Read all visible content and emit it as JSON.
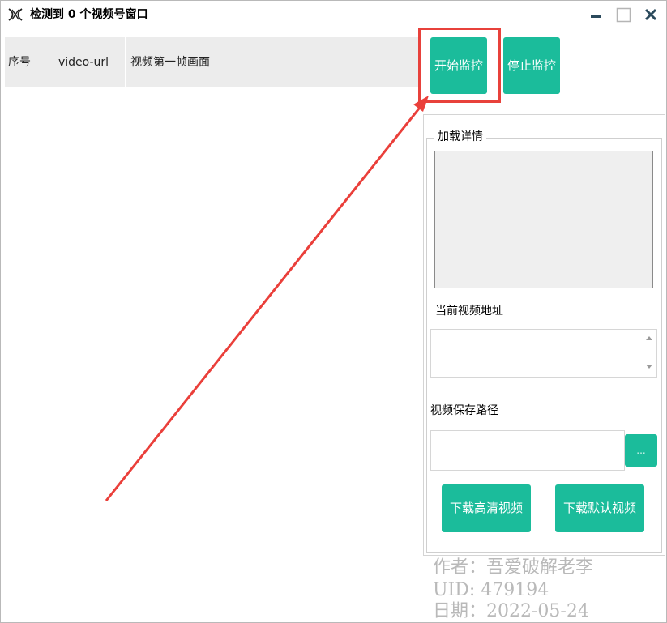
{
  "window": {
    "title": "检测到 0 个视频号窗口",
    "controls": {
      "minimize": "minimize-icon",
      "maximize": "maximize-icon",
      "close": "close-icon"
    }
  },
  "table": {
    "columns": [
      "序号",
      "video-url",
      "视频第一帧画面"
    ]
  },
  "buttons": {
    "start": "开始监控",
    "stop": "停止监控",
    "browse": "...",
    "download_hd": "下载高清视频",
    "download_default": "下载默认视频"
  },
  "details": {
    "legend": "加载详情",
    "current_url_label": "当前视频地址",
    "current_url_value": "",
    "save_path_label": "视频保存路径",
    "save_path_value": ""
  },
  "watermark": {
    "author": "作者：吾爱破解老李",
    "uid": "UID: 479194",
    "date": "日期：2022-05-24"
  },
  "colors": {
    "accent": "#1bbc9b",
    "highlight": "#e8413b",
    "arrow": "#ea3f3a"
  }
}
